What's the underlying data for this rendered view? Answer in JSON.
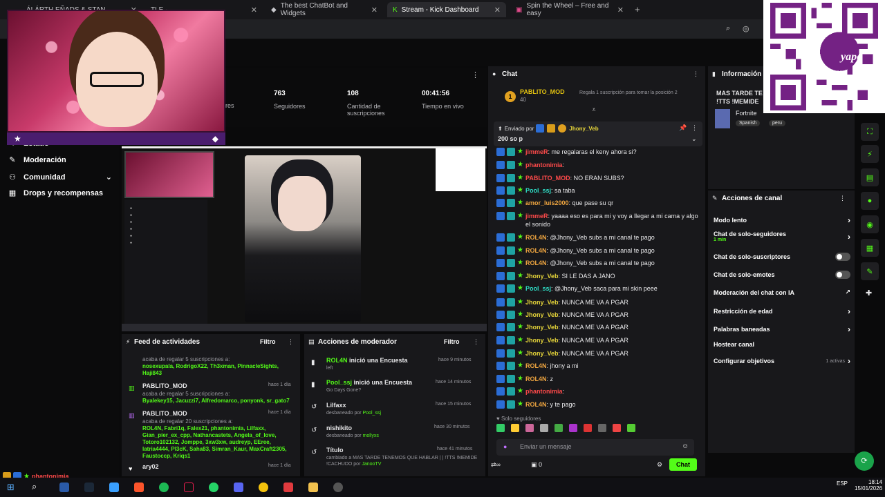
{
  "browser": {
    "tabs": [
      {
        "title": "ÁLÁRTH EÑADS & STAN",
        "active": false
      },
      {
        "title": "TLE · ...",
        "active": false
      },
      {
        "title": "The best ChatBot and Widgets",
        "active": false
      },
      {
        "title": "Stream - Kick Dashboard",
        "active": true
      },
      {
        "title": "Spin the Wheel – Free and easy",
        "active": false
      }
    ],
    "new_tab": "+"
  },
  "stats": [
    {
      "value": "",
      "label": "dores"
    },
    {
      "value": "763",
      "label": "Seguidores"
    },
    {
      "value": "108",
      "label": "Cantidad de suscripciones"
    },
    {
      "value": "00:41:56",
      "label": "Tiempo en vivo"
    }
  ],
  "nav": [
    {
      "label": "Estado",
      "icon": "wave-icon"
    },
    {
      "label": "Moderación",
      "icon": "wrench-icon"
    },
    {
      "label": "Comunidad",
      "icon": "people-icon",
      "expandable": true
    },
    {
      "label": "Drops y recompensas",
      "icon": "gift-icon"
    }
  ],
  "feed": {
    "title": "Feed de actividades",
    "filter": "Filtro",
    "items": [
      {
        "user": "",
        "time": "",
        "text": "acaba de regalar 5 suscripciones a:",
        "names": "nosexupala, RodrigoX22, Th3xman, PinnacleSights, Haji843"
      },
      {
        "user": "PABLITO_MOD",
        "time": "hace 1 día",
        "text": "acaba de regalar 5 suscripciones a:",
        "names": "Byalekey15, Jacuzzi7, Alfredomarco, ponyonk, sr_gato7"
      },
      {
        "user": "PABLITO_MOD",
        "time": "hace 1 día",
        "text": "acaba de regalar 20 suscripciones a:",
        "names": "ROL4N, Fabri1q, Falex21, phantonimia, Lilfaxx, Gian_pier_ex_cpp, Nathancastets, Angela_of_love, Totoro102132, Jomppe, 3xw3xw, audreyp, EEree, latria4444, Pl3cK, Saha83, Simran_Kaur, MaxCraft2305, Faustoccp, Kriqs1"
      },
      {
        "user": "ary02",
        "time": "hace 1 día",
        "text": "",
        "names": ""
      }
    ]
  },
  "modactions": {
    "title": "Acciones de moderador",
    "filter": "Filtro",
    "items": [
      {
        "title_user": "ROL4N",
        "title_rest": " inició una Encuesta",
        "time": "hace 9 minutos",
        "sub": "left",
        "sub_user": ""
      },
      {
        "title_user": "Pool_ssj",
        "title_rest": " inició una Encuesta",
        "time": "hace 14 minutos",
        "sub": "Go Days Gone?",
        "sub_user": ""
      },
      {
        "title_user": "",
        "title_rest": "Lilfaxx",
        "time": "hace 15 minutos",
        "sub": "desbaneado por ",
        "sub_user": "Pool_ssj"
      },
      {
        "title_user": "",
        "title_rest": "nishikito",
        "time": "hace 30 minutos",
        "sub": "desbaneado por ",
        "sub_user": "mollyxs"
      },
      {
        "title_user": "",
        "title_rest": "Título",
        "time": "hace 41 minutos",
        "sub": "cambiado a MAS TARDE TENEMOS QUE HABLAR | | !TTS !MEMIDE !CACHUDO por ",
        "sub_user": "JanooTV"
      }
    ]
  },
  "chat": {
    "title": "Chat",
    "top_user": "PABLITO_MOD",
    "top_count": "40",
    "top_text": "Regala 1 suscripción para tomar la posición 2",
    "pinned_by_label": "Enviado por",
    "pinned_user": "Jhony_Veb",
    "pinned_msg": "200 so p",
    "messages": [
      {
        "user": "jimmeR",
        "cls": "u-red",
        "msg": ": me regalaras el keny ahora si?"
      },
      {
        "user": "phantonimia",
        "cls": "u-red",
        "msg": ":"
      },
      {
        "user": "PABLITO_MOD",
        "cls": "u-red",
        "msg": ": NO ERAN SUBS?"
      },
      {
        "user": "Pool_ssj",
        "cls": "u-teal",
        "msg": ": sa taba"
      },
      {
        "user": "amor_luis2000",
        "cls": "u-orange",
        "msg": ": que pase su qr"
      },
      {
        "user": "jimmeR",
        "cls": "u-red",
        "msg": ": yaaaa eso es para mi y voy a llegar a mi cama y algo el sonido"
      },
      {
        "user": "ROL4N",
        "cls": "u-orange",
        "msg": ": @Jhony_Veb subs a mi canal te pago"
      },
      {
        "user": "ROL4N",
        "cls": "u-orange",
        "msg": ": @Jhony_Veb subs a mi canal te pago"
      },
      {
        "user": "ROL4N",
        "cls": "u-orange",
        "msg": ": @Jhony_Veb subs a mi canal te pago"
      },
      {
        "user": "Jhony_Veb",
        "cls": "u-yellow",
        "msg": ": SI LE DAS A JANO"
      },
      {
        "user": "Pool_ssj",
        "cls": "u-teal",
        "msg": ": @Jhony_Veb saca para mi skin peee"
      },
      {
        "user": "Jhony_Veb",
        "cls": "u-yellow",
        "msg": ": NUNCA ME VA A PGAR"
      },
      {
        "user": "Jhony_Veb",
        "cls": "u-yellow",
        "msg": ": NUNCA ME VA A PGAR"
      },
      {
        "user": "Jhony_Veb",
        "cls": "u-yellow",
        "msg": ": NUNCA ME VA A PGAR"
      },
      {
        "user": "Jhony_Veb",
        "cls": "u-yellow",
        "msg": ": NUNCA ME VA A PGAR"
      },
      {
        "user": "Jhony_Veb",
        "cls": "u-yellow",
        "msg": ": NUNCA ME VA A PGAR"
      },
      {
        "user": "ROL4N",
        "cls": "u-orange",
        "msg": ": jhony a mi"
      },
      {
        "user": "ROL4N",
        "cls": "u-orange",
        "msg": ": z"
      },
      {
        "user": "phantonimia",
        "cls": "u-red",
        "msg": ":"
      },
      {
        "user": "ROL4N",
        "cls": "u-orange",
        "msg": ": y te pago"
      }
    ],
    "followers_only": "Solo seguidores",
    "input_placeholder": "Enviar un mensaje",
    "viewer_count": "0",
    "send_label": "Chat"
  },
  "info": {
    "title": "Información d",
    "stream_title": "MAS TARDE TE",
    "stream_title2": "!TTS !MEMIDE",
    "category": "Fortnite",
    "tags": [
      "Spanish",
      "peru"
    ]
  },
  "channel_actions": {
    "title": "Acciones de canal",
    "items": [
      {
        "label": "Modo lento",
        "kind": "chevron",
        "sub": ""
      },
      {
        "label": "Chat de solo-seguidores",
        "kind": "chevron",
        "sub": "1 min"
      },
      {
        "label": "Chat de solo-suscriptores",
        "kind": "toggle",
        "sub": ""
      },
      {
        "label": "Chat de solo-emotes",
        "kind": "toggle",
        "sub": ""
      },
      {
        "label": "Moderación del chat con IA",
        "kind": "external",
        "sub": ""
      },
      {
        "label": "Restricción de edad",
        "kind": "chevron",
        "sub": ""
      },
      {
        "label": "Palabras baneadas",
        "kind": "chevron",
        "sub": ""
      },
      {
        "label": "Hostear canal",
        "kind": "none",
        "sub": ""
      },
      {
        "label": "Configurar objetivos",
        "kind": "chevron",
        "sub": "1 activas"
      }
    ]
  },
  "bottom_left": {
    "user": "phantonimia"
  },
  "taskbar": {
    "lang": "ESP",
    "time": "18:14",
    "date": "15/01/2026"
  },
  "qr": {
    "brand": "yape"
  }
}
